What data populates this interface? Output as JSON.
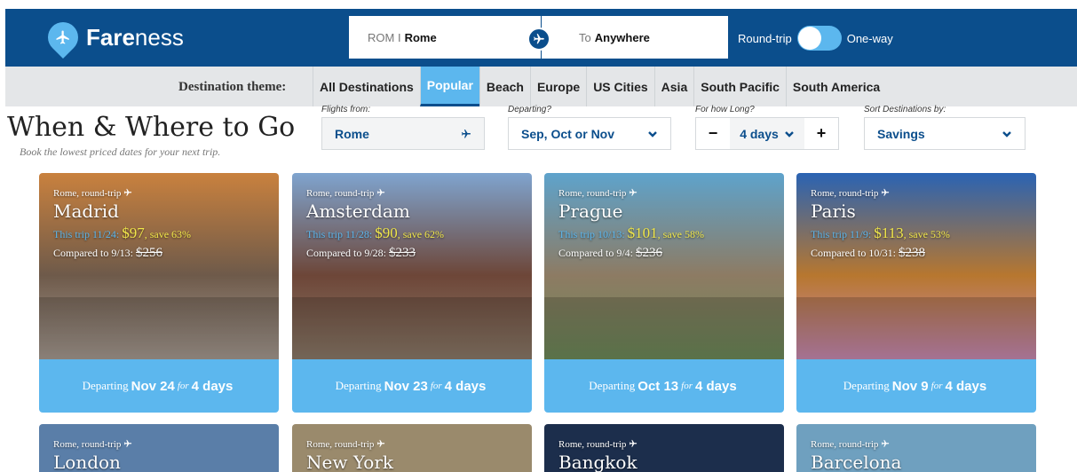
{
  "brand": {
    "name_bold": "Fare",
    "name_rest": "ness"
  },
  "search": {
    "from_code": "ROM I",
    "from_city": "Rome",
    "to_prefix": "To",
    "to_city": "Anywhere",
    "round_trip_label": "Round-trip",
    "one_way_label": "One-way"
  },
  "theme": {
    "label": "Destination theme:",
    "tabs": [
      "All Destinations",
      "Popular",
      "Beach",
      "Europe",
      "US Cities",
      "Asia",
      "South Pacific",
      "South America"
    ],
    "active": "Popular"
  },
  "heading": {
    "title": "When & Where to Go",
    "subtitle": "Book the lowest priced dates for your next trip."
  },
  "filters": {
    "from": {
      "label": "Flights from:",
      "value": "Rome"
    },
    "departing": {
      "label": "Departing?",
      "value": "Sep, Oct or Nov"
    },
    "length": {
      "label": "For how Long?",
      "value": "4 days",
      "minus": "−",
      "plus": "+"
    },
    "sort": {
      "label": "Sort Destinations by:",
      "value": "Savings"
    }
  },
  "cards": [
    {
      "origin": "Rome, round-trip",
      "city": "Madrid",
      "deal_label": "This trip 11/24:",
      "price": "$97",
      "save": ", save 63%",
      "compare_label": "Compared to 9/13:",
      "old_price": "$256",
      "departing": "Departing",
      "date": "Nov 24",
      "for": "for",
      "days": "4 days",
      "palette": [
        "#c9813e",
        "#6e5a4a",
        "#a99d93"
      ]
    },
    {
      "origin": "Rome, round-trip",
      "city": "Amsterdam",
      "deal_label": "This trip 11/28:",
      "price": "$90",
      "save": ", save 62%",
      "compare_label": "Compared to 9/28:",
      "old_price": "$233",
      "departing": "Departing",
      "date": "Nov 23",
      "for": "for",
      "days": "4 days",
      "palette": [
        "#7fa4cf",
        "#6d4638",
        "#8e7c6a"
      ]
    },
    {
      "origin": "Rome, round-trip",
      "city": "Prague",
      "deal_label": "This trip 10/13:",
      "price": "$101",
      "save": ", save 58%",
      "compare_label": "Compared to 9/4:",
      "old_price": "$236",
      "departing": "Departing",
      "date": "Oct 13",
      "for": "for",
      "days": "4 days",
      "palette": [
        "#5ea3cc",
        "#8d7b63",
        "#6e8b5a"
      ]
    },
    {
      "origin": "Rome, round-trip",
      "city": "Paris",
      "deal_label": "This trip 11/9:",
      "price": "$113",
      "save": ", save 53%",
      "compare_label": "Compared to 10/31:",
      "old_price": "$238",
      "departing": "Departing",
      "date": "Nov 9",
      "for": "for",
      "days": "4 days",
      "palette": [
        "#2a63b3",
        "#b7772f",
        "#c98bb4"
      ]
    }
  ],
  "cards_row2": [
    {
      "origin": "Rome, round-trip",
      "city": "London",
      "color": "#5a7ea8"
    },
    {
      "origin": "Rome, round-trip",
      "city": "New York",
      "color": "#9a8a6c"
    },
    {
      "origin": "Rome, round-trip",
      "city": "Bangkok",
      "color": "#1c2e4c"
    },
    {
      "origin": "Rome, round-trip",
      "city": "Barcelona",
      "color": "#6fa0bf"
    }
  ]
}
